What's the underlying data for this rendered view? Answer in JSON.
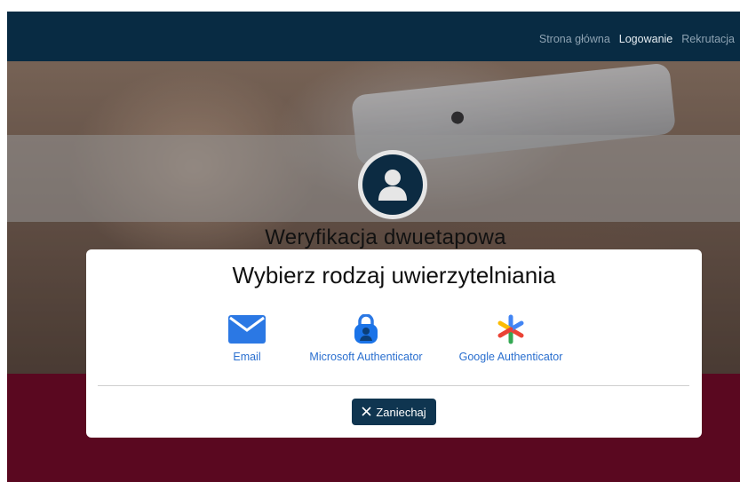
{
  "nav": {
    "items": [
      {
        "label": "Strona główna",
        "active": false
      },
      {
        "label": "Logowanie",
        "active": true
      },
      {
        "label": "Rekrutacja",
        "active": false
      }
    ]
  },
  "hero": {
    "title": "Weryfikacja dwuetapowa",
    "avatar_icon": "user-icon"
  },
  "modal": {
    "title": "Wybierz rodzaj uwierzytelniania",
    "options": [
      {
        "label": "Email",
        "icon": "envelope-icon"
      },
      {
        "label": "Microsoft Authenticator",
        "icon": "lock-person-icon"
      },
      {
        "label": "Google Authenticator",
        "icon": "asterisk-icon"
      }
    ],
    "cancel_label": "Zaniechaj",
    "cancel_icon": "close-icon"
  },
  "colors": {
    "navbar": "#082b43",
    "accent": "#0f3550",
    "link": "#2a6fcf",
    "footer": "#5a0820"
  }
}
